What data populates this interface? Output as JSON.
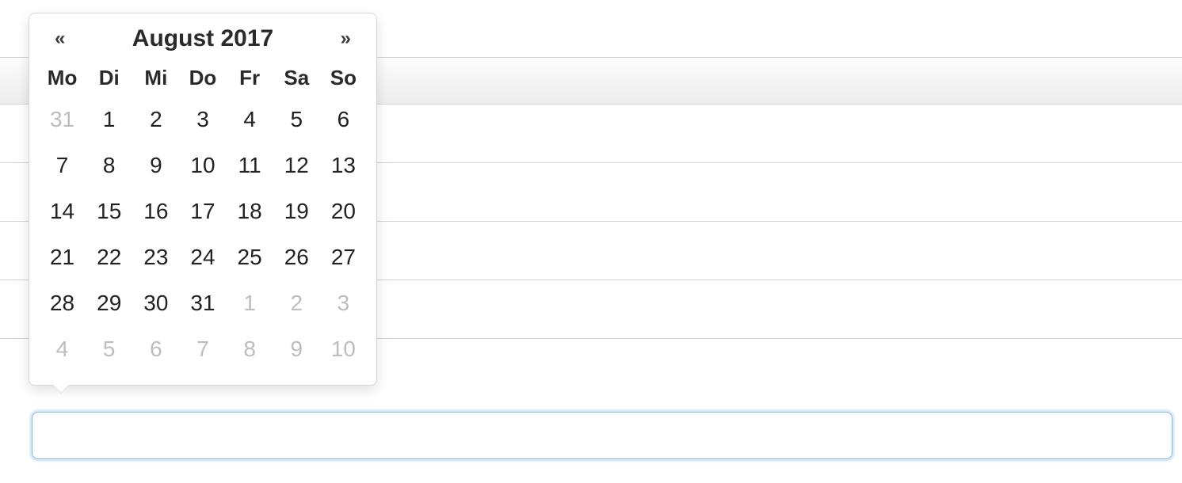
{
  "datepicker": {
    "prev_glyph": "«",
    "next_glyph": "»",
    "title": "August 2017",
    "dow": [
      "Mo",
      "Di",
      "Mi",
      "Do",
      "Fr",
      "Sa",
      "So"
    ],
    "weeks": [
      [
        {
          "d": "31",
          "muted": true
        },
        {
          "d": "1"
        },
        {
          "d": "2"
        },
        {
          "d": "3"
        },
        {
          "d": "4"
        },
        {
          "d": "5"
        },
        {
          "d": "6"
        }
      ],
      [
        {
          "d": "7"
        },
        {
          "d": "8"
        },
        {
          "d": "9"
        },
        {
          "d": "10"
        },
        {
          "d": "11"
        },
        {
          "d": "12"
        },
        {
          "d": "13"
        }
      ],
      [
        {
          "d": "14"
        },
        {
          "d": "15"
        },
        {
          "d": "16"
        },
        {
          "d": "17"
        },
        {
          "d": "18"
        },
        {
          "d": "19"
        },
        {
          "d": "20"
        }
      ],
      [
        {
          "d": "21"
        },
        {
          "d": "22"
        },
        {
          "d": "23"
        },
        {
          "d": "24"
        },
        {
          "d": "25"
        },
        {
          "d": "26"
        },
        {
          "d": "27"
        }
      ],
      [
        {
          "d": "28"
        },
        {
          "d": "29"
        },
        {
          "d": "30"
        },
        {
          "d": "31"
        },
        {
          "d": "1",
          "muted": true
        },
        {
          "d": "2",
          "muted": true
        },
        {
          "d": "3",
          "muted": true
        }
      ],
      [
        {
          "d": "4",
          "muted": true
        },
        {
          "d": "5",
          "muted": true
        },
        {
          "d": "6",
          "muted": true
        },
        {
          "d": "7",
          "muted": true
        },
        {
          "d": "8",
          "muted": true
        },
        {
          "d": "9",
          "muted": true
        },
        {
          "d": "10",
          "muted": true
        }
      ]
    ]
  },
  "input": {
    "value": ""
  }
}
